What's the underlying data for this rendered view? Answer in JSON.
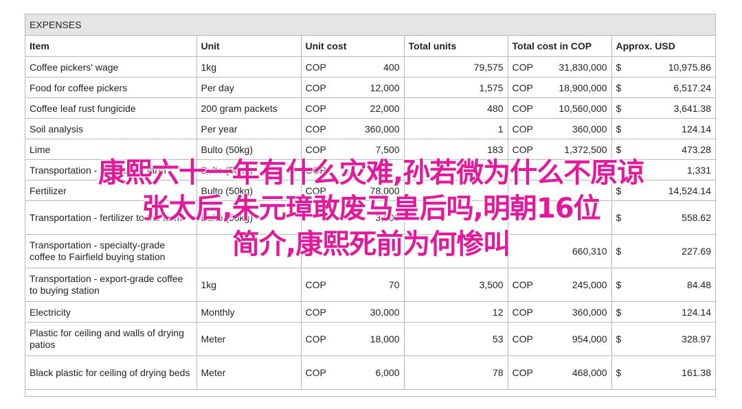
{
  "sheet_title": "EXPENSES",
  "headers": [
    "Item",
    "Unit",
    "Unit cost",
    "Total units",
    "Total cost in COP",
    "Approx. USD"
  ],
  "rows": [
    {
      "item": "Coffee pickers' wage",
      "unit": "1kg",
      "cur": "COP",
      "unit_cost": "400",
      "total_units": "79,575",
      "cur2": "COP",
      "total_cost": "31,830,000",
      "usd_sym": "$",
      "usd": "10,975.86",
      "tall": false
    },
    {
      "item": "Food for coffee pickers",
      "unit": "Per day",
      "cur": "COP",
      "unit_cost": "12,000",
      "total_units": "1,575",
      "cur2": "COP",
      "total_cost": "18,900,000",
      "usd_sym": "$",
      "usd": "6,517.24",
      "tall": false
    },
    {
      "item": "Coffee leaf rust fungicide",
      "unit": "200 gram packets",
      "cur": "COP",
      "unit_cost": "22,000",
      "total_units": "480",
      "cur2": "COP",
      "total_cost": "10,560,000",
      "usd_sym": "$",
      "usd": "3,641.38",
      "tall": false
    },
    {
      "item": "Soil analysis",
      "unit": "Per year",
      "cur": "COP",
      "unit_cost": "360,000",
      "total_units": "1",
      "cur2": "COP",
      "total_cost": "360,000",
      "usd_sym": "$",
      "usd": "124.14",
      "tall": false
    },
    {
      "item": "Lime",
      "unit": "Bulto (50kg)",
      "cur": "COP",
      "unit_cost": "7,500",
      "total_units": "183",
      "cur2": "COP",
      "total_cost": "1,372,500",
      "usd_sym": "$",
      "usd": "473.28",
      "tall": false
    },
    {
      "item": "Transportation - lime to the farm",
      "unit": "Bulto (50kg)",
      "cur": "COP",
      "unit_cost": "",
      "total_units": "",
      "cur2": "",
      "total_cost": "",
      "usd_sym": "",
      "usd": "1,331",
      "tall": false
    },
    {
      "item": "Fertilizer",
      "unit": "Bulto (50kg)",
      "cur": "COP",
      "unit_cost": "78,000",
      "total_units": "",
      "cur2": "",
      "total_cost": "",
      "usd_sym": "$",
      "usd": "14,524.14",
      "tall": false
    },
    {
      "item": "Transportation - fertilizer to the farm",
      "unit": "Bulto (50kg)",
      "cur": "",
      "unit_cost": "3,000",
      "total_units": "",
      "cur2": "",
      "total_cost": "",
      "usd_sym": "$",
      "usd": "558.62",
      "tall": true
    },
    {
      "item": "Transportation - specialty-grade coffee to Fairfield buying station",
      "unit": "",
      "cur": "",
      "unit_cost": "",
      "total_units": "",
      "cur2": "",
      "total_cost": "660,310",
      "usd_sym": "$",
      "usd": "227.69",
      "tall": true
    },
    {
      "item": "Transportation - export-grade coffee to buying station",
      "unit": "1kg",
      "cur": "COP",
      "unit_cost": "70",
      "total_units": "3,500",
      "cur2": "COP",
      "total_cost": "245,000",
      "usd_sym": "$",
      "usd": "84.48",
      "tall": true
    },
    {
      "item": "Electricity",
      "unit": "Monthly",
      "cur": "COP",
      "unit_cost": "30,000",
      "total_units": "12",
      "cur2": "COP",
      "total_cost": "360,000",
      "usd_sym": "$",
      "usd": "124.14",
      "tall": false
    },
    {
      "item": "Plastic for ceiling and walls of drying patios",
      "unit": "Meter",
      "cur": "COP",
      "unit_cost": "18,000",
      "total_units": "53",
      "cur2": "COP",
      "total_cost": "954,000",
      "usd_sym": "$",
      "usd": "328.97",
      "tall": true
    },
    {
      "item": "Black plastic for ceiling of drying beds",
      "unit": "Meter",
      "cur": "COP",
      "unit_cost": "6,000",
      "total_units": "78",
      "cur2": "COP",
      "total_cost": "468,000",
      "usd_sym": "$",
      "usd": "161.38",
      "tall": true
    }
  ],
  "overlay": {
    "line1": "康熙六十一年有什么灾难,孙若微为什么不原谅",
    "line2": "张太后,朱元璋敢废马皇后吗,明朝16位",
    "line3": "简介,康熙死前为何惨叫"
  }
}
